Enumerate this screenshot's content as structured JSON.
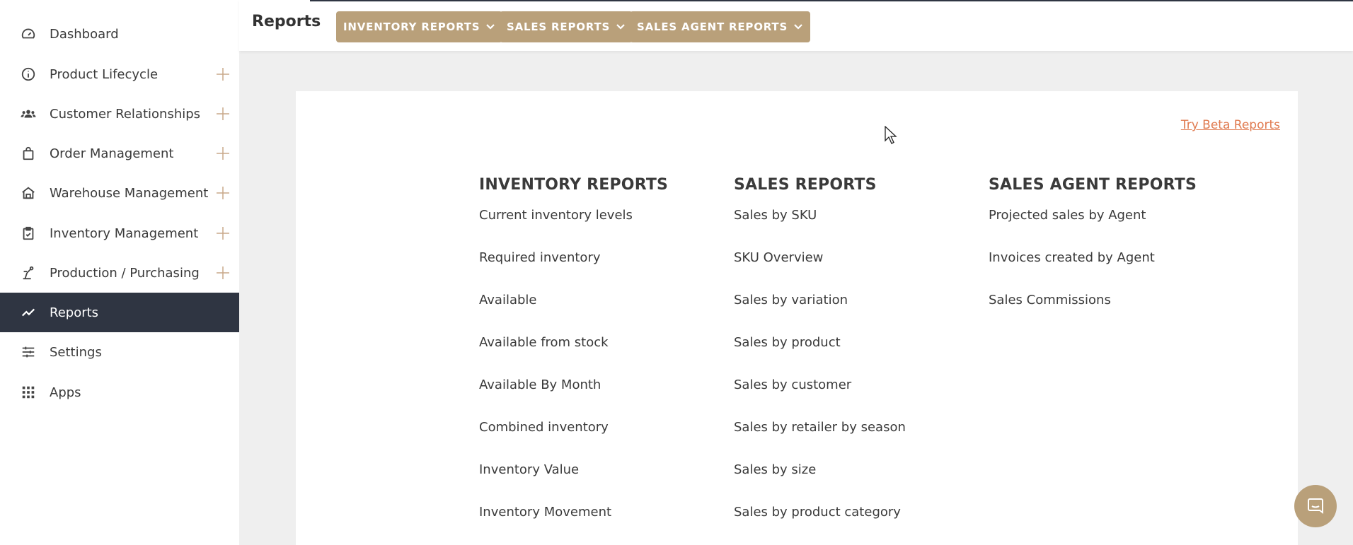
{
  "sidebar": {
    "items": [
      {
        "label": "Dashboard",
        "icon": "gauge-icon",
        "expandable": false,
        "active": false
      },
      {
        "label": "Product Lifecycle",
        "icon": "info-icon",
        "expandable": true,
        "active": false
      },
      {
        "label": "Customer Relationships",
        "icon": "people-icon",
        "expandable": true,
        "active": false
      },
      {
        "label": "Order Management",
        "icon": "shopping-bag-icon",
        "expandable": true,
        "active": false
      },
      {
        "label": "Warehouse Management",
        "icon": "warehouse-icon",
        "expandable": true,
        "active": false
      },
      {
        "label": "Inventory Management",
        "icon": "clipboard-check-icon",
        "expandable": true,
        "active": false
      },
      {
        "label": "Production / Purchasing",
        "icon": "machine-icon",
        "expandable": true,
        "active": false
      },
      {
        "label": "Reports",
        "icon": "trend-line-icon",
        "expandable": false,
        "active": true
      },
      {
        "label": "Settings",
        "icon": "sliders-icon",
        "expandable": false,
        "active": false
      },
      {
        "label": "Apps",
        "icon": "grid-icon",
        "expandable": false,
        "active": false
      }
    ]
  },
  "header": {
    "title": "Reports",
    "dropdowns": [
      {
        "label": "INVENTORY REPORTS"
      },
      {
        "label": "SALES REPORTS"
      },
      {
        "label": "SALES AGENT REPORTS"
      }
    ]
  },
  "main": {
    "beta_link": "Try Beta Reports",
    "columns": [
      {
        "title": "INVENTORY REPORTS",
        "items": [
          "Current inventory levels",
          "Required inventory",
          "Available",
          "Available from stock",
          "Available By Month",
          "Combined inventory",
          "Inventory Value",
          "Inventory Movement"
        ]
      },
      {
        "title": "SALES REPORTS",
        "items": [
          "Sales by SKU",
          "SKU Overview",
          "Sales by variation",
          "Sales by product",
          "Sales by customer",
          "Sales by retailer by season",
          "Sales by size",
          "Sales by product category"
        ]
      },
      {
        "title": "SALES AGENT REPORTS",
        "items": [
          "Projected sales by Agent",
          "Invoices created by Agent",
          "Sales Commissions"
        ]
      }
    ]
  },
  "colors": {
    "accent": "#b9a07a",
    "sidebar_active": "#2f3542",
    "link": "#e07a4f"
  }
}
